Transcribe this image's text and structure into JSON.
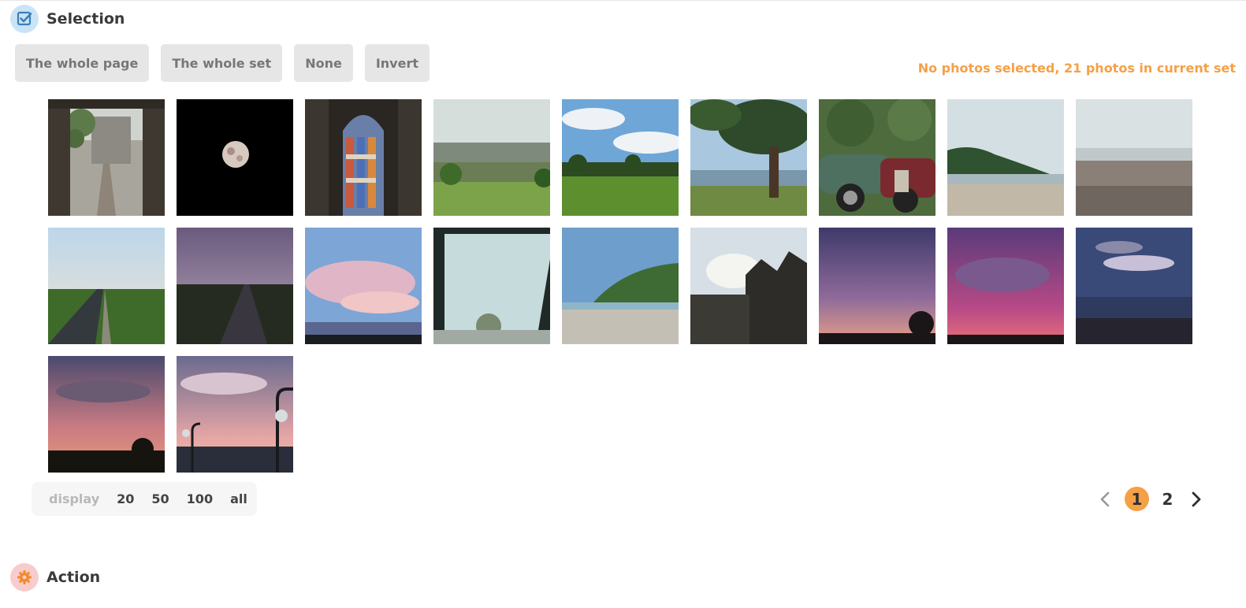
{
  "selection_section": {
    "title": "Selection",
    "icon": "checkbox-icon",
    "buttons": {
      "whole_page": "The whole page",
      "whole_set": "The whole set",
      "none": "None",
      "invert": "Invert"
    },
    "status_text": "No photos selected, 21 photos in current set",
    "status_color": "#f5a046"
  },
  "photos": [
    {
      "name": "stone-doorway-courtyard"
    },
    {
      "name": "full-moon-night"
    },
    {
      "name": "stained-glass-window"
    },
    {
      "name": "green-valley-landscape"
    },
    {
      "name": "wheat-field-trees"
    },
    {
      "name": "tree-by-the-sea"
    },
    {
      "name": "vintage-cars"
    },
    {
      "name": "coastal-cliff-beach"
    },
    {
      "name": "pebble-beach"
    },
    {
      "name": "country-road-field"
    },
    {
      "name": "dusk-field-path"
    },
    {
      "name": "pink-clouds-sky"
    },
    {
      "name": "rainy-window"
    },
    {
      "name": "sandy-beach-headland"
    },
    {
      "name": "town-street-houses"
    },
    {
      "name": "purple-dusk-sky"
    },
    {
      "name": "magenta-sunset-clouds"
    },
    {
      "name": "evening-sea-clouds"
    },
    {
      "name": "sunset-clouds-silhouette"
    },
    {
      "name": "sunset-street-lamps"
    }
  ],
  "display": {
    "label": "display",
    "options": [
      "20",
      "50",
      "100",
      "all"
    ]
  },
  "pagination": {
    "current": "1",
    "next_page": "2",
    "accent": "#f5a046"
  },
  "action_section": {
    "title": "Action",
    "icon": "gear-icon"
  }
}
